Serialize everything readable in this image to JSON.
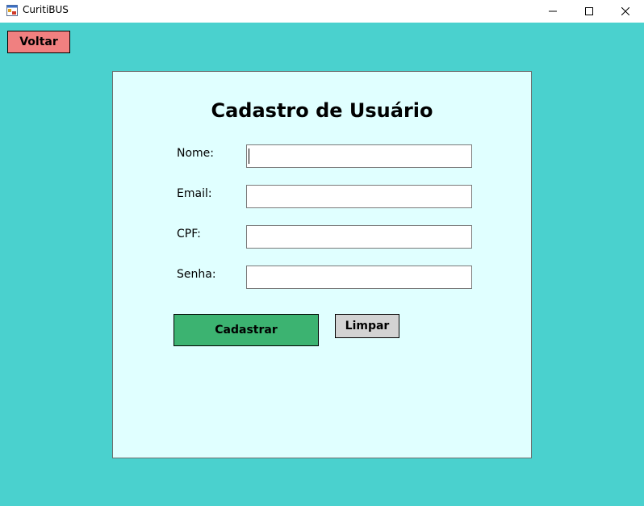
{
  "window": {
    "title": "CuritiBUS",
    "icon": "app-form-icon",
    "controls": [
      "minimize-icon",
      "maximize-icon",
      "close-icon"
    ]
  },
  "colors": {
    "background": "#4AD1CE",
    "panel": "#E0FFFF",
    "voltar_button": "#F08080",
    "cadastrar_button": "#3CB371",
    "limpar_button": "#D3D3D3"
  },
  "nav": {
    "back_label": "Voltar"
  },
  "form": {
    "title": "Cadastro de Usuário",
    "fields": [
      {
        "label": "Nome:",
        "value": ""
      },
      {
        "label": "Email:",
        "value": ""
      },
      {
        "label": "CPF:",
        "value": ""
      },
      {
        "label": "Senha:",
        "value": ""
      }
    ],
    "submit_label": "Cadastrar",
    "clear_label": "Limpar"
  }
}
